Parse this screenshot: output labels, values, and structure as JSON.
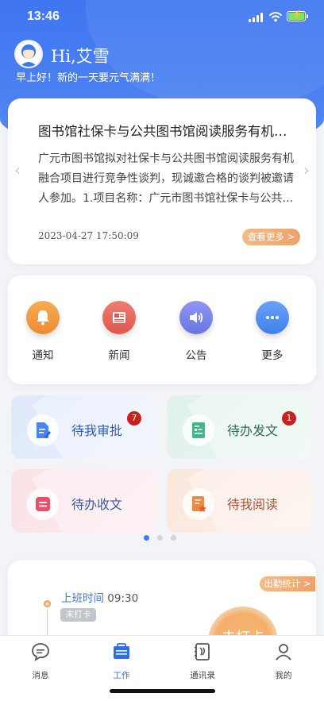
{
  "status": {
    "time": "13:46"
  },
  "header": {
    "name": "Hi,艾雪",
    "greeting": "早上好！新的一天要元气满满！"
  },
  "notice": {
    "title": "图书馆社保卡与公共图书馆阅读服务有机…",
    "body": "广元市图书馆拟对社保卡与公共图书馆阅读服务有机融合项目进行竞争性谈判，现诚邀合格的谈判被邀请人参加。1.项目名称：广元市图书馆社保卡与公共…",
    "date": "2023-04-27 17:50:09",
    "more": "查看更多 >",
    "prev": "‹",
    "next": "›"
  },
  "quick": {
    "items": [
      {
        "label": "通知",
        "icon": "bell-icon",
        "color": "#f19a3e"
      },
      {
        "label": "新闻",
        "icon": "newspaper-icon",
        "color": "#e8645a"
      },
      {
        "label": "公告",
        "icon": "speaker-icon",
        "color": "#7c86ea"
      },
      {
        "label": "更多",
        "icon": "more-icon",
        "color": "#4f8ef2"
      }
    ]
  },
  "tasks": [
    {
      "label": "待我审批",
      "badge": "7",
      "icon": "approval-doc-icon"
    },
    {
      "label": "待办发文",
      "badge": "1",
      "icon": "send-doc-icon"
    },
    {
      "label": "待办收文",
      "badge": "",
      "icon": "receive-doc-icon"
    },
    {
      "label": "待我阅读",
      "badge": "",
      "icon": "read-doc-icon"
    }
  ],
  "pager": {
    "count": 3,
    "active": 0
  },
  "attendance": {
    "stats": "出勤统计 >",
    "label": "上班时间",
    "time": "09:30",
    "state": "未打卡",
    "punch": "去打卡"
  },
  "tabbar": {
    "items": [
      {
        "label": "消息",
        "icon": "message-icon"
      },
      {
        "label": "工作",
        "icon": "work-icon",
        "active": true
      },
      {
        "label": "通讯录",
        "icon": "contacts-icon"
      },
      {
        "label": "我的",
        "icon": "profile-icon"
      }
    ]
  }
}
